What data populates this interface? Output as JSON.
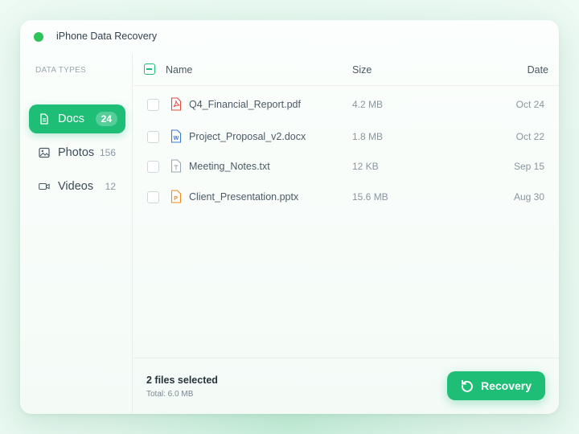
{
  "app": {
    "title": "iPhone Data Recovery",
    "status_color": "#2ec45a",
    "accent": "#1fbe77"
  },
  "sidebar": {
    "heading": "DATA TYPES",
    "items": [
      {
        "label": "Docs",
        "count": "24",
        "icon": "document-icon",
        "active": true
      },
      {
        "label": "Photos",
        "count": "156",
        "icon": "image-icon",
        "active": false
      },
      {
        "label": "Videos",
        "count": "12",
        "icon": "video-icon",
        "active": false
      }
    ]
  },
  "table": {
    "columns": {
      "name": "Name",
      "size": "Size",
      "date": "Date"
    },
    "rows": [
      {
        "name": "Q4_Financial_Report.pdf",
        "size": "4.2 MB",
        "date": "Oct 24",
        "icon": "pdf-icon",
        "checked": false
      },
      {
        "name": "Project_Proposal_v2.docx",
        "size": "1.8 MB",
        "date": "Oct 22",
        "icon": "word-icon",
        "checked": false
      },
      {
        "name": "Meeting_Notes.txt",
        "size": "12 KB",
        "date": "Sep 15",
        "icon": "text-file-icon",
        "checked": false
      },
      {
        "name": "Client_Presentation.pptx",
        "size": "15.6 MB",
        "date": "Aug 30",
        "icon": "powerpoint-icon",
        "checked": false
      }
    ]
  },
  "footer": {
    "selected": "2 files selected",
    "total": "Total: 6.0 MB",
    "button_label": "Recovery"
  }
}
